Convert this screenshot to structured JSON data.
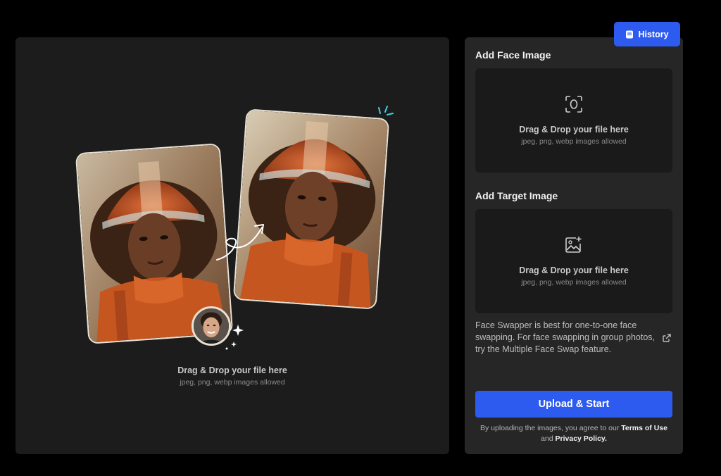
{
  "header": {
    "history_label": "History"
  },
  "preview": {
    "drop_title": "Drag & Drop your file here",
    "drop_subtitle": "jpeg, png, webp images allowed"
  },
  "face_section": {
    "title": "Add Face Image",
    "drop_title": "Drag & Drop your file here",
    "drop_subtitle": "jpeg, png, webp images allowed",
    "icon": "face-scan-icon"
  },
  "target_section": {
    "title": "Add Target Image",
    "drop_title": "Drag & Drop your file here",
    "drop_subtitle": "jpeg, png, webp images allowed",
    "icon": "image-add-icon"
  },
  "info": {
    "text": "Face Swapper is best for one-to-one face swapping. For face swapping in group photos, try the Multiple Face Swap feature.",
    "link_icon": "external-link-icon"
  },
  "cta": {
    "label": "Upload & Start"
  },
  "terms": {
    "prefix": "By uploading the images, you agree to our ",
    "terms_link": "Terms of Use",
    "and": " and ",
    "privacy_link": "Privacy Policy",
    "suffix": "."
  },
  "colors": {
    "accent": "#2d5bf0",
    "panel_dark": "#1c1c1c",
    "panel_right": "#262626",
    "dropzone": "#1a1a1a"
  }
}
